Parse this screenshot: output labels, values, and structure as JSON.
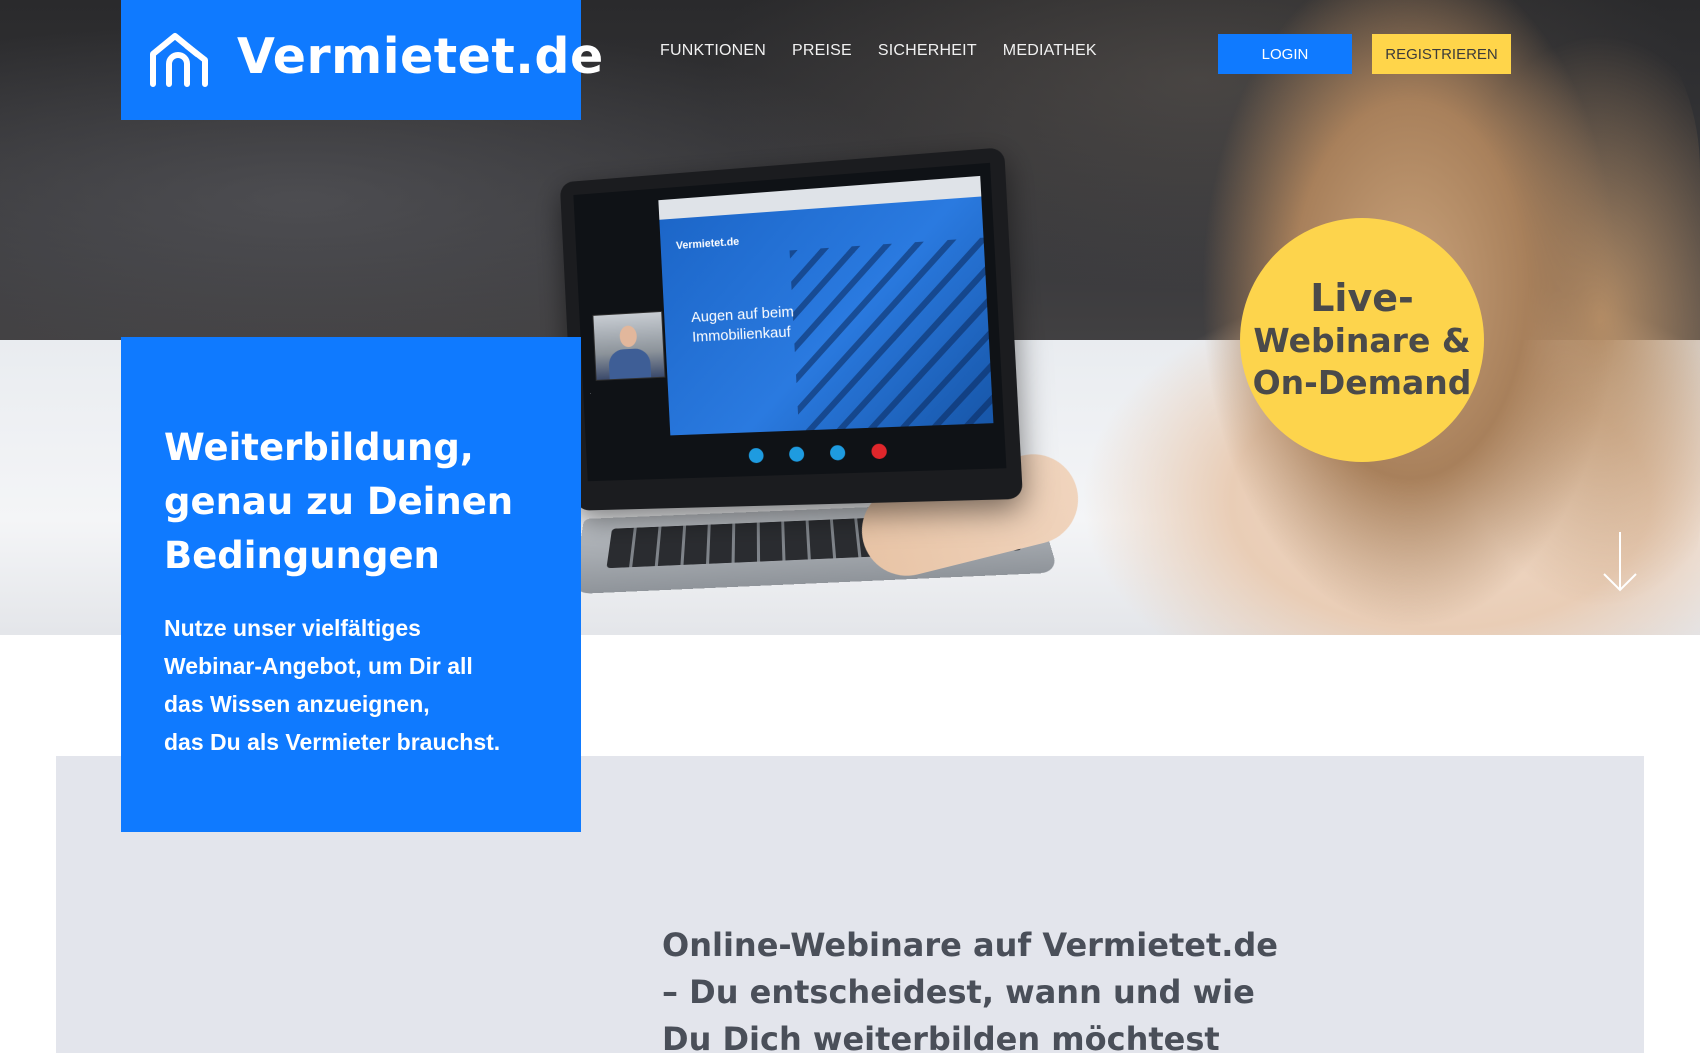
{
  "brand": {
    "name": "Vermietet.de",
    "logo_icon": "house-outline-icon",
    "primary_color": "#0f7aff",
    "accent_color": "#ffd54a"
  },
  "nav": {
    "items": [
      "FUNKTIONEN",
      "PREISE",
      "SICHERHEIT",
      "MEDIATHEK"
    ]
  },
  "header": {
    "login_label": "LOGIN",
    "register_label": "REGISTRIEREN"
  },
  "hero": {
    "badge": {
      "line1": "Live-",
      "line2": "Webinare &",
      "line3": "On-Demand"
    },
    "laptop": {
      "slide_logo": "Vermietet.de",
      "slide_title": "Augen auf beim Immobilienkauf"
    },
    "scroll_icon": "arrow-down-icon"
  },
  "intro": {
    "title": "Weiterbildung, genau zu Deinen Bedingungen",
    "text_lines": [
      "Nutze unser vielfältiges",
      "Webinar-Angebot, um Dir all",
      "das Wissen anzueignen,",
      "das Du als Vermieter brauchst."
    ]
  },
  "section": {
    "heading": "Online-Webinare auf Vermietet.de – Du entscheidest, wann und wie Du Dich weiterbilden möchtest"
  }
}
